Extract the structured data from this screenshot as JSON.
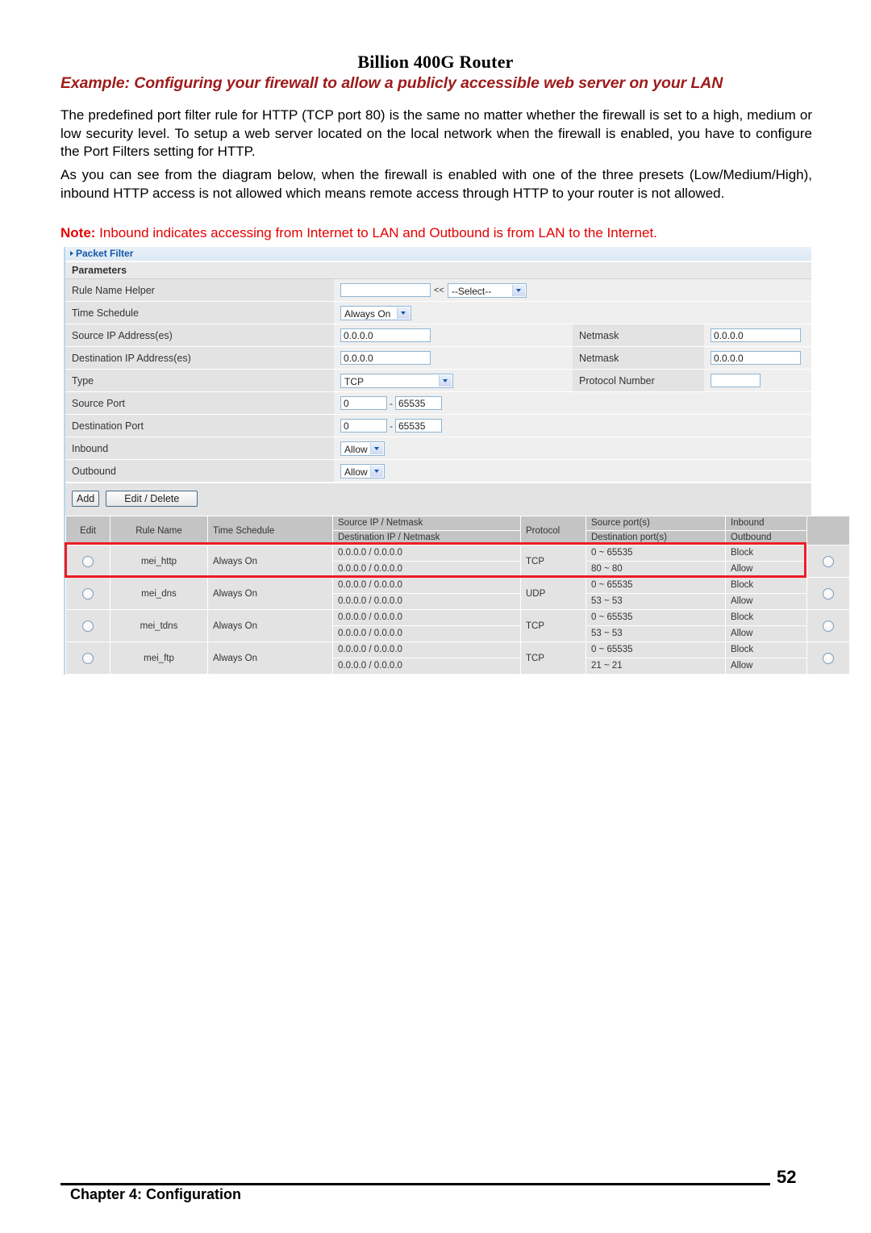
{
  "document": {
    "running_head": "Billion 400G Router",
    "example_heading": "Example: Configuring your firewall to allow a publicly accessible web server on your LAN",
    "paragraph_1": "The predefined port filter rule for HTTP (TCP port 80) is the same no matter whether the firewall is set to a high, medium or low security level. To setup a web server located on the local network when the firewall is enabled, you have to configure the Port Filters setting for HTTP.",
    "paragraph_2": "As you can see from the diagram below, when the firewall is enabled with one of the three presets (Low/Medium/High), inbound HTTP access is not allowed which means remote access through HTTP to your router is not allowed.",
    "note_label": "Note:",
    "note_text": " Inbound indicates accessing from Internet to LAN and Outbound is from LAN to the Internet.",
    "footer_chapter": "Chapter 4: Configuration",
    "footer_page_number": "52",
    "heading_color": "#9e1b1b",
    "note_color": "#e60000"
  },
  "panel": {
    "title": "Packet Filter",
    "section_header": "Parameters",
    "title_color": "#1457a8",
    "highlight_color": "#ed1c24",
    "form": {
      "rule_name_helper": {
        "label": "Rule Name  Helper",
        "value": "",
        "separator": "<<",
        "select_value": "--Select--"
      },
      "time_schedule": {
        "label": "Time Schedule",
        "value": "Always On"
      },
      "source_ip": {
        "label": "Source IP Address(es)",
        "value": "0.0.0.0",
        "netmask_label": "Netmask",
        "netmask_value": "0.0.0.0"
      },
      "destination_ip": {
        "label": "Destination IP Address(es)",
        "value": "0.0.0.0",
        "netmask_label": "Netmask",
        "netmask_value": "0.0.0.0"
      },
      "type": {
        "label": "Type",
        "value": "TCP",
        "protocol_number_label": "Protocol Number",
        "protocol_number_value": ""
      },
      "source_port": {
        "label": "Source Port",
        "from": "0",
        "dash": "-",
        "to": "65535"
      },
      "destination_port": {
        "label": "Destination Port",
        "from": "0",
        "dash": "-",
        "to": "65535"
      },
      "inbound": {
        "label": "Inbound",
        "value": "Allow"
      },
      "outbound": {
        "label": "Outbound",
        "value": "Allow"
      }
    },
    "buttons": {
      "add": "Add",
      "edit_delete": "Edit / Delete"
    },
    "grid": {
      "headers": {
        "edit": "Edit",
        "rule_name": "Rule Name",
        "time_schedule": "Time Schedule",
        "ip_netmask_top": "Source IP / Netmask",
        "ip_netmask_bottom": "Destination IP / Netmask",
        "protocol": "Protocol",
        "ports_top": "Source port(s)",
        "ports_bottom": "Destination port(s)",
        "inout_top": "Inbound",
        "inout_bottom": "Outbound",
        "select": ""
      },
      "rows": [
        {
          "rule_name": "mei_http",
          "time_schedule": "Always On",
          "source_ip_netmask": "0.0.0.0 / 0.0.0.0",
          "destination_ip_netmask": "0.0.0.0 / 0.0.0.0",
          "protocol": "TCP",
          "source_ports": "0 ~ 65535",
          "destination_ports": "80 ~ 80",
          "inbound": "Block",
          "outbound": "Allow",
          "highlighted": true
        },
        {
          "rule_name": "mei_dns",
          "time_schedule": "Always On",
          "source_ip_netmask": "0.0.0.0 / 0.0.0.0",
          "destination_ip_netmask": "0.0.0.0 / 0.0.0.0",
          "protocol": "UDP",
          "source_ports": "0 ~ 65535",
          "destination_ports": "53 ~ 53",
          "inbound": "Block",
          "outbound": "Allow",
          "highlighted": false
        },
        {
          "rule_name": "mei_tdns",
          "time_schedule": "Always On",
          "source_ip_netmask": "0.0.0.0 / 0.0.0.0",
          "destination_ip_netmask": "0.0.0.0 / 0.0.0.0",
          "protocol": "TCP",
          "source_ports": "0 ~ 65535",
          "destination_ports": "53 ~ 53",
          "inbound": "Block",
          "outbound": "Allow",
          "highlighted": false
        },
        {
          "rule_name": "mei_ftp",
          "time_schedule": "Always On",
          "source_ip_netmask": "0.0.0.0 / 0.0.0.0",
          "destination_ip_netmask": "0.0.0.0 / 0.0.0.0",
          "protocol": "TCP",
          "source_ports": "0 ~ 65535",
          "destination_ports": "21 ~ 21",
          "inbound": "Block",
          "outbound": "Allow",
          "highlighted": false
        }
      ]
    }
  }
}
